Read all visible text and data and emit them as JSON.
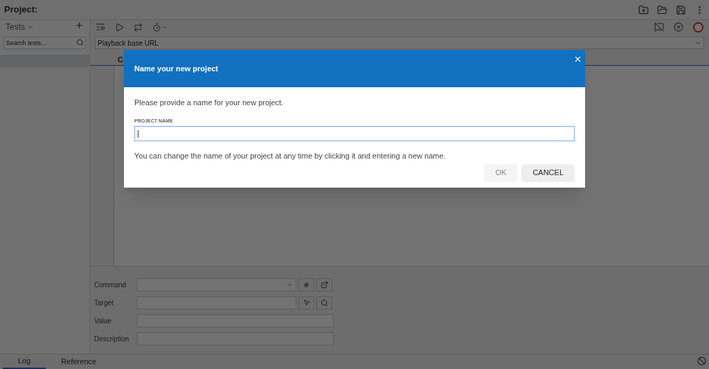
{
  "project": {
    "label": "Project:"
  },
  "sidebar": {
    "title": "Tests",
    "search": {
      "placeholder": "Search tests..."
    }
  },
  "url_field": {
    "placeholder": "Playback base URL"
  },
  "table": {
    "column_1": "C"
  },
  "editor": {
    "fields": [
      {
        "label": "Command",
        "kind": "dropdown"
      },
      {
        "label": "Target",
        "kind": "locator"
      },
      {
        "label": "Value",
        "kind": "text"
      },
      {
        "label": "Description",
        "kind": "text"
      }
    ]
  },
  "bottom_tabs": [
    {
      "label": "Log",
      "selected": true
    },
    {
      "label": "Reference",
      "selected": false
    }
  ],
  "dialog": {
    "title": "Name your new project",
    "message": "Please provide a name for your new project.",
    "field": {
      "label": "PROJECT NAME",
      "focused": true
    },
    "hint": "You can change the name of your project at any time by clicking it and entering a new name.",
    "buttons": [
      {
        "label": "OK",
        "disabled": true
      },
      {
        "label": "CANCEL",
        "disabled": false
      }
    ]
  }
}
